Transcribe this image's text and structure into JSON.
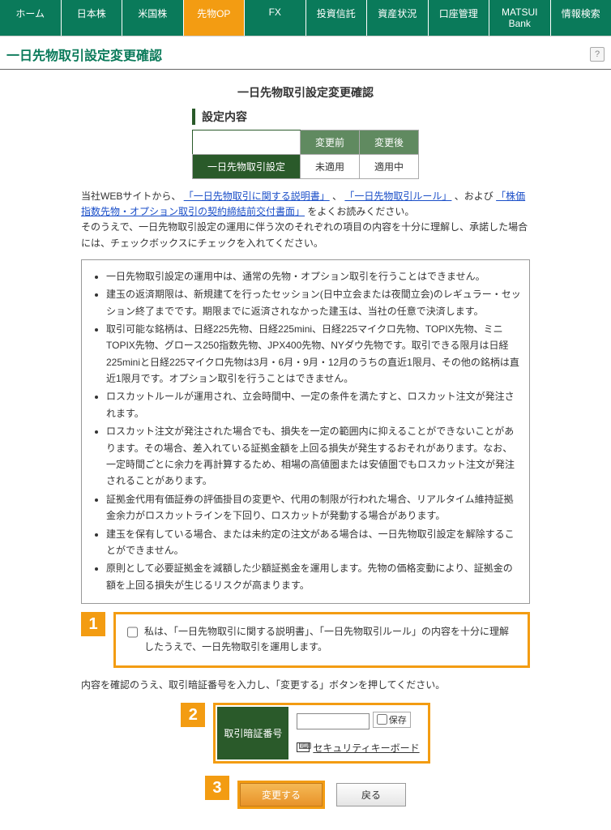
{
  "nav": {
    "items": [
      "ホーム",
      "日本株",
      "米国株",
      "先物OP",
      "FX",
      "投資信託",
      "資産状況",
      "口座管理",
      "MATSUI Bank",
      "情報検索"
    ],
    "active_index": 3
  },
  "page_title": "一日先物取引設定変更確認",
  "help_label": "?",
  "sub_title": "一日先物取引設定変更確認",
  "section_header": "設定内容",
  "settings_table": {
    "row_label": "一日先物取引設定",
    "col_before": "変更前",
    "col_after": "変更後",
    "val_before": "未適用",
    "val_after": "適用中"
  },
  "intro": {
    "prefix": "当社WEBサイトから、",
    "link1": "「一日先物取引に関する説明書」",
    "sep1": "、",
    "link2": "「一日先物取引ルール」",
    "sep2": "、および",
    "link3": "「株価指数先物・オプション取引の契約締結前交付書面」",
    "suffix1": "をよくお読みください。",
    "line2": "そのうえで、一日先物取引設定の運用に伴う次のそれぞれの項目の内容を十分に理解し、承諾した場合には、チェックボックスにチェックを入れてください。"
  },
  "notes": [
    "一日先物取引設定の運用中は、通常の先物・オプション取引を行うことはできません。",
    "建玉の返済期限は、新規建てを行ったセッション(日中立会または夜間立会)のレギュラー・セッション終了までです。期限までに返済されなかった建玉は、当社の任意で決済します。",
    "取引可能な銘柄は、日経225先物、日経225mini、日経225マイクロ先物、TOPIX先物、ミニTOPIX先物、グロース250指数先物、JPX400先物、NYダウ先物です。取引できる限月は日経225miniと日経225マイクロ先物は3月・6月・9月・12月のうちの直近1限月、その他の銘柄は直近1限月です。オプション取引を行うことはできません。",
    "ロスカットルールが運用され、立会時間中、一定の条件を満たすと、ロスカット注文が発注されます。",
    "ロスカット注文が発注された場合でも、損失を一定の範囲内に抑えることができないことがあります。その場合、差入れている証拠金額を上回る損失が発生するおそれがあります。なお、一定時間ごとに余力を再計算するため、相場の高値圏または安値圏でもロスカット注文が発注されることがあります。",
    "証拠金代用有価証券の評価掛目の変更や、代用の制限が行われた場合、リアルタイム維持証拠金余力がロスカットラインを下回り、ロスカットが発動する場合があります。",
    "建玉を保有している場合、または未約定の注文がある場合は、一日先物取引設定を解除することができません。",
    "原則として必要証拠金を減額した少額証拠金を運用します。先物の価格変動により、証拠金の額を上回る損失が生じるリスクが高まります。"
  ],
  "step1": {
    "num": "1",
    "ack_text": "私は、「一日先物取引に関する説明書」、「一日先物取引ルール」の内容を十分に理解したうえで、一日先物取引を運用します。"
  },
  "hint": "内容を確認のうえ、取引暗証番号を入力し、「変更する」ボタンを押してください。",
  "step2": {
    "num": "2",
    "pin_label": "取引暗証番号",
    "pin_value": "",
    "save_label": "保存",
    "seckb_label": "セキュリティキーボード"
  },
  "step3": {
    "num": "3",
    "submit_label": "変更する",
    "back_label": "戻る"
  }
}
